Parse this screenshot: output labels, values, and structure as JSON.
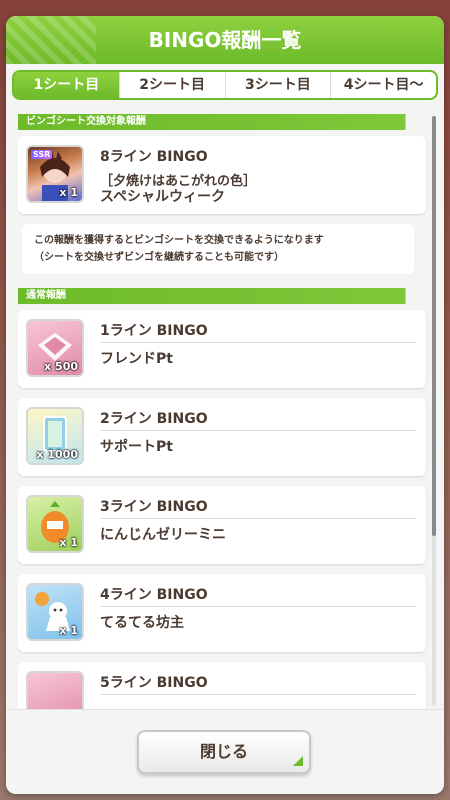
{
  "dialog": {
    "title": "BINGO報酬一覧"
  },
  "tabs": [
    {
      "label": "1シート目",
      "active": true
    },
    {
      "label": "2シート目",
      "active": false
    },
    {
      "label": "3シート目",
      "active": false
    },
    {
      "label": "4シート目〜",
      "active": false
    }
  ],
  "exchange_section": {
    "header": "ビンゴシート交換対象報酬",
    "card": {
      "line": "8ライン BINGO",
      "subtitle": "［夕焼けはあこがれの色］",
      "reward": "スペシャルウィーク",
      "badge": "SSR",
      "qty": "x 1",
      "icon": "support-card-icon"
    },
    "notice_lines": [
      "この報酬を獲得するとビンゴシートを交換できるようになります",
      "（シートを交換せずビンゴを継続することも可能です）"
    ]
  },
  "normal_section": {
    "header": "通常報酬",
    "cards": [
      {
        "line": "1ライン BINGO",
        "reward": "フレンドPt",
        "qty": "x 500",
        "icon": "handshake-icon",
        "color": "#e9a2b8"
      },
      {
        "line": "2ライン BINGO",
        "reward": "サポートPt",
        "qty": "x 1000",
        "icon": "support-pt-icon",
        "color": "#a9d8e8"
      },
      {
        "line": "3ライン BINGO",
        "reward": "にんじんゼリーミニ",
        "qty": "x 1",
        "icon": "carrot-jelly-icon",
        "color": "#bfe18a"
      },
      {
        "line": "4ライン BINGO",
        "reward": "てるてる坊主",
        "qty": "x 1",
        "icon": "teru-teru-bozu-icon",
        "color": "#a8d4ef"
      },
      {
        "line": "5ライン BINGO",
        "reward": "",
        "qty": "",
        "icon": "reward-icon",
        "color": "#e9a2b8"
      }
    ]
  },
  "footer": {
    "close_label": "閉じる"
  },
  "colors": {
    "accent": "#6dba2a",
    "text": "#4a3a30"
  }
}
